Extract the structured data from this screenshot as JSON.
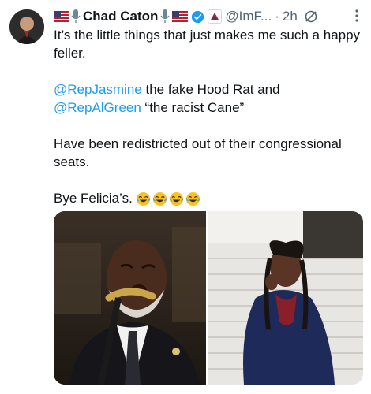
{
  "author": {
    "name": "Chad Caton",
    "handle": "@ImF...",
    "separator": "·",
    "time": "2h"
  },
  "tweet": {
    "line1": "It’s the little things that just makes me such a happy feller.",
    "mention1": "@RepJasmine",
    "mention1_rest": " the fake Hood Rat and",
    "mention2": "@RepAlGreen",
    "mention2_rest": " “the racist Cane”",
    "line3": "Have been redistricted out of their congressional seats.",
    "line4": "Bye Felicia’s."
  },
  "icons": [
    "us-flag-icon",
    "microphone-icon",
    "verified-badge-icon",
    "affiliate-badge-icon",
    "edited-icon",
    "more-options-icon",
    "laughing-emoji-icon"
  ],
  "colors": {
    "text": "#0f1419",
    "secondary": "#536471",
    "link": "#1d9bf0"
  }
}
